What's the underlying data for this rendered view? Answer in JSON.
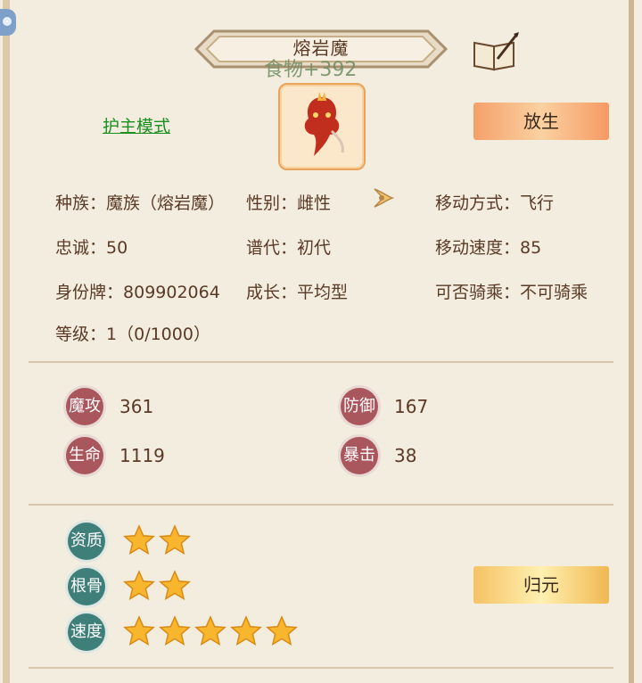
{
  "title": "熔岩魔",
  "food_bonus": "食物+392",
  "guard_mode": "护主模式",
  "release_label": "放生",
  "reset_label": "归元",
  "info": {
    "race_label": "种族：",
    "race_value": "魔族（熔岩魔）",
    "gender_label": "性别：",
    "gender_value": "雌性",
    "move_method_label": "移动方式：",
    "move_method_value": "飞行",
    "loyalty_label": "忠诚：",
    "loyalty_value": "50",
    "generation_label": "谱代：",
    "generation_value": "初代",
    "move_speed_label": "移动速度：",
    "move_speed_value": "85",
    "id_label": "身份牌：",
    "id_value": "809902064",
    "growth_label": "成长：",
    "growth_value": "平均型",
    "rideable_label": "可否骑乘：",
    "rideable_value": "不可骑乘",
    "level_label": "等级：",
    "level_value": "1（0/1000）"
  },
  "stats": {
    "magic_attack_label": "魔攻",
    "magic_attack_value": "361",
    "defense_label": "防御",
    "defense_value": "167",
    "hp_label": "生命",
    "hp_value": "1119",
    "crit_label": "暴击",
    "crit_value": "38"
  },
  "aptitude": {
    "talent_label": "资质",
    "talent_stars": 2,
    "bone_label": "根骨",
    "bone_stars": 2,
    "speed_label": "速度",
    "speed_stars": 5
  },
  "colors": {
    "stat_badge": "#a9565d",
    "aptitude_badge": "#3f7f7a",
    "guard_link": "#1b8f1f"
  }
}
